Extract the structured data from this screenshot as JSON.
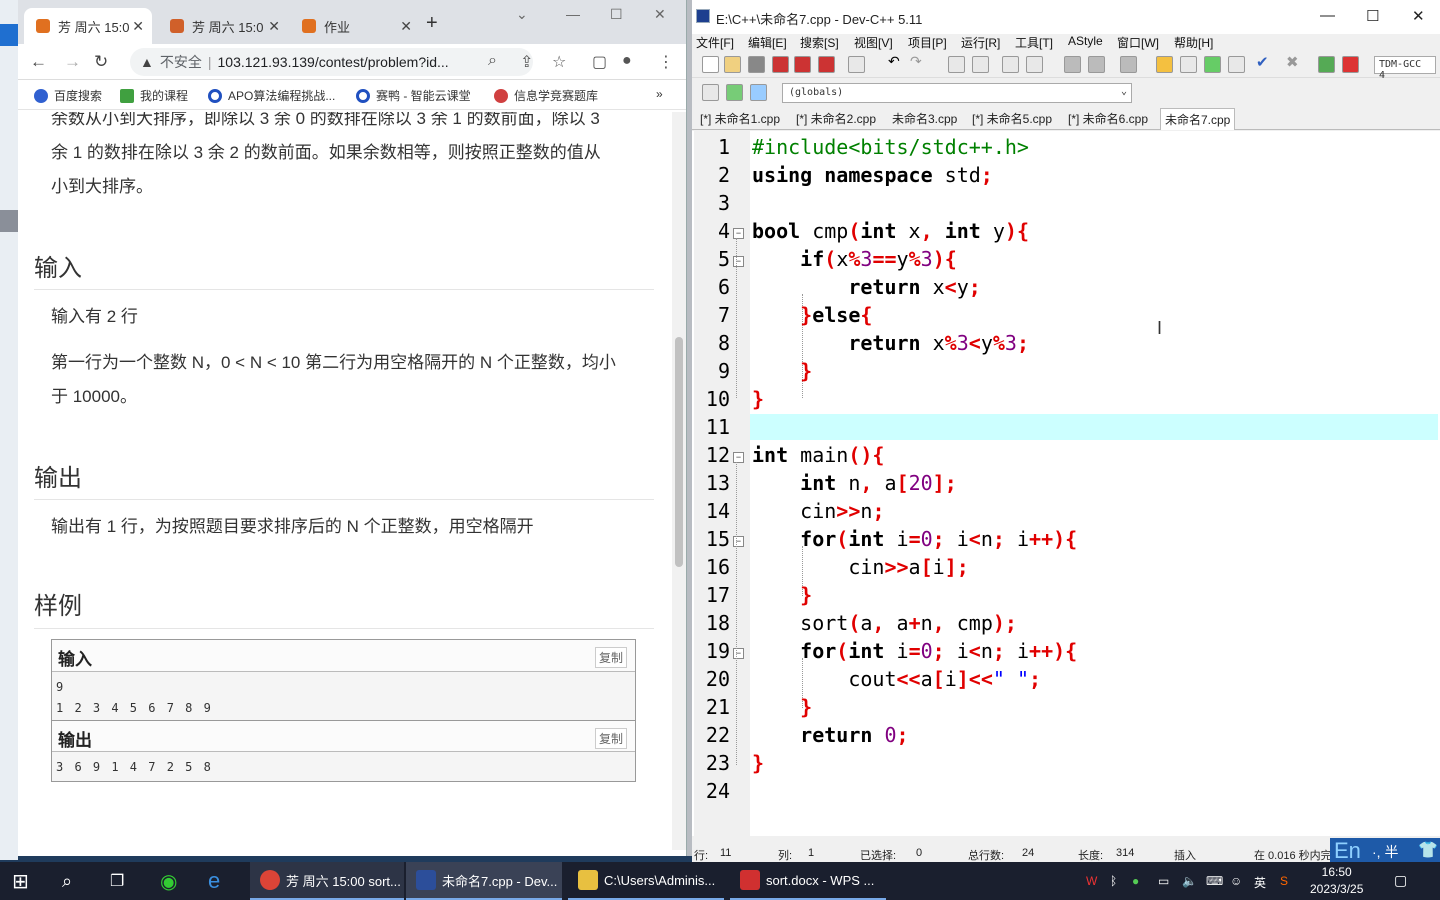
{
  "browser": {
    "tabs": [
      {
        "label": "芳 周六 15:0"
      },
      {
        "label": "芳 周六 15:0"
      },
      {
        "label": "作业"
      }
    ],
    "address": {
      "security": "不安全",
      "url": "103.121.93.139/contest/problem?id..."
    },
    "bookmarks": [
      "百度搜索",
      "我的课程",
      "APO算法编程挑战...",
      "赛鸭 - 智能云课堂",
      "信息学竞赛题库"
    ]
  },
  "problem": {
    "desc_lines": [
      "余数从小到大排序，即除以 3 余 0 的数排在除以 3 余 1 的数前面，除以 3",
      "余 1 的数排在除以 3 余 2 的数前面。如果余数相等，则按照正整数的值从",
      "小到大排序。"
    ],
    "input_title": "输入",
    "input_lines": [
      "输入有 2 行",
      "第一行为一个整数 N，0 < N < 10 第二行为用空格隔开的 N 个正整数，均小",
      "于 10000。"
    ],
    "output_title": "输出",
    "output_text": "输出有 1 行，为按照题目要求排序后的 N 个正整数，用空格隔开",
    "sample_title": "样例",
    "sample_in_label": "输入",
    "sample_out_label": "输出",
    "copy_label": "复制",
    "sample_in": [
      "9",
      "1 2 3 4 5 6 7 8 9"
    ],
    "sample_out": [
      "3 6 9 1 4 7 2 5 8"
    ]
  },
  "dev": {
    "title": "E:\\C++\\未命名7.cpp - Dev-C++ 5.11",
    "menu": [
      "文件[F]",
      "编辑[E]",
      "搜索[S]",
      "视图[V]",
      "项目[P]",
      "运行[R]",
      "工具[T]",
      "AStyle",
      "窗口[W]",
      "帮助[H]"
    ],
    "globals": "(globals)",
    "compiler": "TDM-GCC 4",
    "file_tabs": [
      "[*] 未命名1.cpp",
      "[*] 未命名2.cpp",
      "未命名3.cpp",
      "[*] 未命名5.cpp",
      "[*] 未命名6.cpp",
      "未命名7.cpp"
    ],
    "status": {
      "row_label": "行:",
      "row": "11",
      "col_label": "列:",
      "col": "1",
      "sel_label": "已选择:",
      "sel": "0",
      "lines_label": "总行数:",
      "lines": "24",
      "len_label": "长度:",
      "len": "314",
      "mode": "插入",
      "time": "在 0.016 秒内完"
    }
  },
  "ime": {
    "lang": "En",
    "extra": "·, 半"
  },
  "taskbar": {
    "tasks": [
      "芳 周六 15:00 sort...",
      "未命名7.cpp - Dev...",
      "C:\\Users\\Adminis...",
      "sort.docx - WPS ..."
    ],
    "ime_tray": "英",
    "time": "16:50",
    "date": "2023/3/25"
  }
}
